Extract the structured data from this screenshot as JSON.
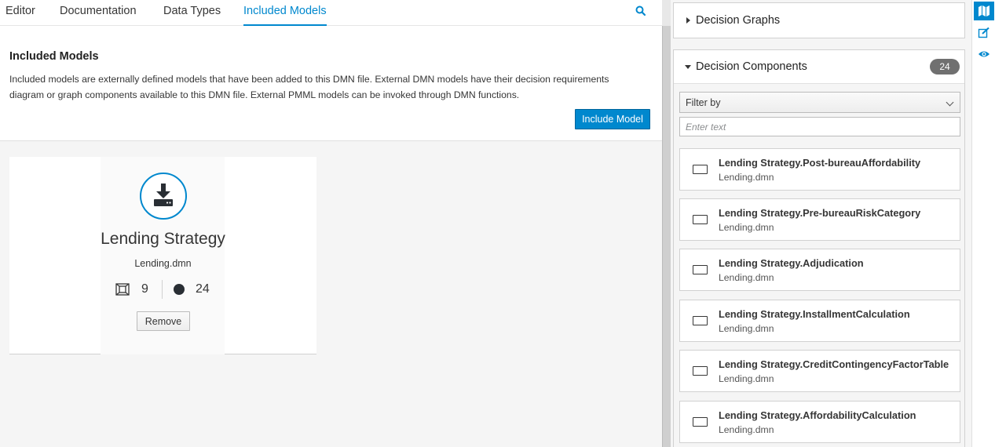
{
  "tabs": [
    {
      "label": "Editor",
      "active": false
    },
    {
      "label": "Documentation",
      "active": false
    },
    {
      "label": "Data Types",
      "active": false
    },
    {
      "label": "Included Models",
      "active": true
    }
  ],
  "header": {
    "title": "Included Models",
    "description": "Included models are externally defined models that have been added to this DMN file. External DMN models have their decision requirements diagram or graph components available to this DMN file. External PMML models can be invoked through DMN functions.",
    "include_button": "Include Model"
  },
  "card": {
    "icon": "import-icon",
    "title": "Lending Strategy",
    "file": "Lending.dmn",
    "drg_count": "9",
    "component_count": "24",
    "remove_button": "Remove"
  },
  "right_panel": {
    "graphs_title": "Decision Graphs",
    "components_title": "Decision Components",
    "components_badge": "24",
    "filter_label": "Filter by",
    "filter_placeholder": "Enter text",
    "items": [
      {
        "name": "Lending Strategy.Post-bureauAffordability",
        "file": "Lending.dmn"
      },
      {
        "name": "Lending Strategy.Pre-bureauRiskCategory",
        "file": "Lending.dmn"
      },
      {
        "name": "Lending Strategy.Adjudication",
        "file": "Lending.dmn"
      },
      {
        "name": "Lending Strategy.InstallmentCalculation",
        "file": "Lending.dmn"
      },
      {
        "name": "Lending Strategy.CreditContingencyFactorTable",
        "file": "Lending.dmn"
      },
      {
        "name": "Lending Strategy.AffordabilityCalculation",
        "file": "Lending.dmn"
      }
    ]
  },
  "toolbar": [
    "map-icon",
    "edit-icon",
    "eye-icon"
  ],
  "colors": {
    "accent": "#0088ce",
    "badge": "#707070"
  }
}
